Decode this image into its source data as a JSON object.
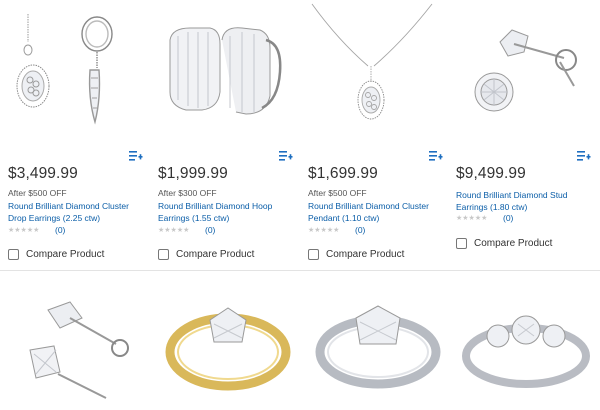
{
  "products_row1": [
    {
      "price": "$3,499.99",
      "discount": "After $500 OFF",
      "title_l1": "Round Brilliant Diamond Cluster",
      "title_l2": "Drop Earrings (2.25 ctw)",
      "reviews": "(0)",
      "compare": "Compare Product",
      "icon": "add-to-list-icon"
    },
    {
      "price": "$1,999.99",
      "discount": "After $300 OFF",
      "title_l1": "Round Brilliant Diamond Hoop",
      "title_l2": "Earrings (1.55 ctw)",
      "reviews": "(0)",
      "compare": "Compare Product",
      "icon": "add-to-list-icon"
    },
    {
      "price": "$1,699.99",
      "discount": "After $500 OFF",
      "title_l1": "Round Brilliant Diamond Cluster",
      "title_l2": "Pendant (1.10 ctw)",
      "reviews": "(0)",
      "compare": "Compare Product",
      "icon": "add-to-list-icon"
    },
    {
      "price": "$9,499.99",
      "discount": "",
      "title_l1": "Round Brilliant Diamond Stud",
      "title_l2": "Earrings (1.80 ctw)",
      "reviews": "(0)",
      "compare": "Compare Product",
      "icon": "add-to-list-icon"
    }
  ],
  "products_row2": [
    {
      "image": "princess-stud-earrings-image"
    },
    {
      "image": "two-tone-solitaire-ring-image"
    },
    {
      "image": "platinum-solitaire-ring-image"
    },
    {
      "image": "three-stone-ring-image"
    }
  ],
  "colors": {
    "link": "#0b5ea8",
    "price": "#333333",
    "stars": "#c8c8c8"
  }
}
